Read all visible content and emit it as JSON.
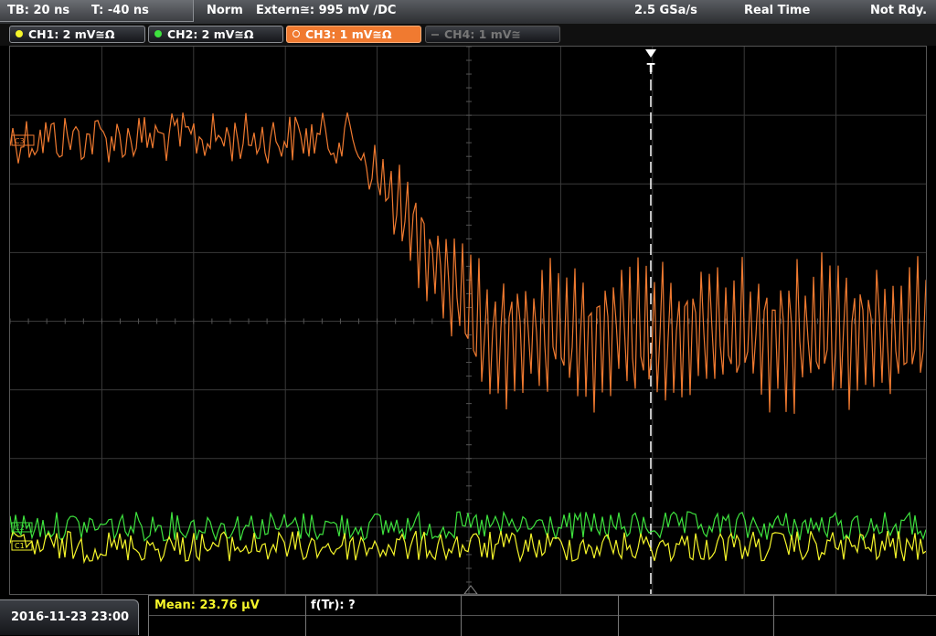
{
  "topbar": {
    "timebase": "TB: 20 ns",
    "trigger_time": "T: -40 ns",
    "trigger_mode": "Norm",
    "trigger_source": "Extern≅: 995 mV ∕DC",
    "sample_rate": "2.5 GSa/s",
    "acq_mode": "Real Time",
    "status": "Not Rdy."
  },
  "channels": [
    {
      "label": "CH1: 2 mV≅Ω",
      "color": "#f5f52a",
      "state": "on"
    },
    {
      "label": "CH2: 2 mV≅Ω",
      "color": "#3ee23e",
      "state": "on"
    },
    {
      "label": "CH3: 1 mV≅Ω",
      "color": "#f07a30",
      "state": "active"
    },
    {
      "label": "CH4: 1 mV≅",
      "color": "#666666",
      "state": "off"
    }
  ],
  "markers": {
    "ch3": "C3",
    "ch2": "C2",
    "ch1": "C1",
    "trigger": "T"
  },
  "bottombar": {
    "datetime": "2016-11-23 23:00",
    "mean": "Mean: 23.76 µV",
    "ftr": "f(Tr): ?"
  },
  "chart_data": {
    "type": "line",
    "grid": {
      "divisions_x": 10,
      "divisions_y": 8
    },
    "series": [
      {
        "name": "CH3",
        "color": "#f07a30",
        "description_level_before": "high",
        "step_at_division": 3.9
      },
      {
        "name": "CH2",
        "color": "#3ee23e"
      },
      {
        "name": "CH1",
        "color": "#f5f52a"
      }
    ]
  }
}
